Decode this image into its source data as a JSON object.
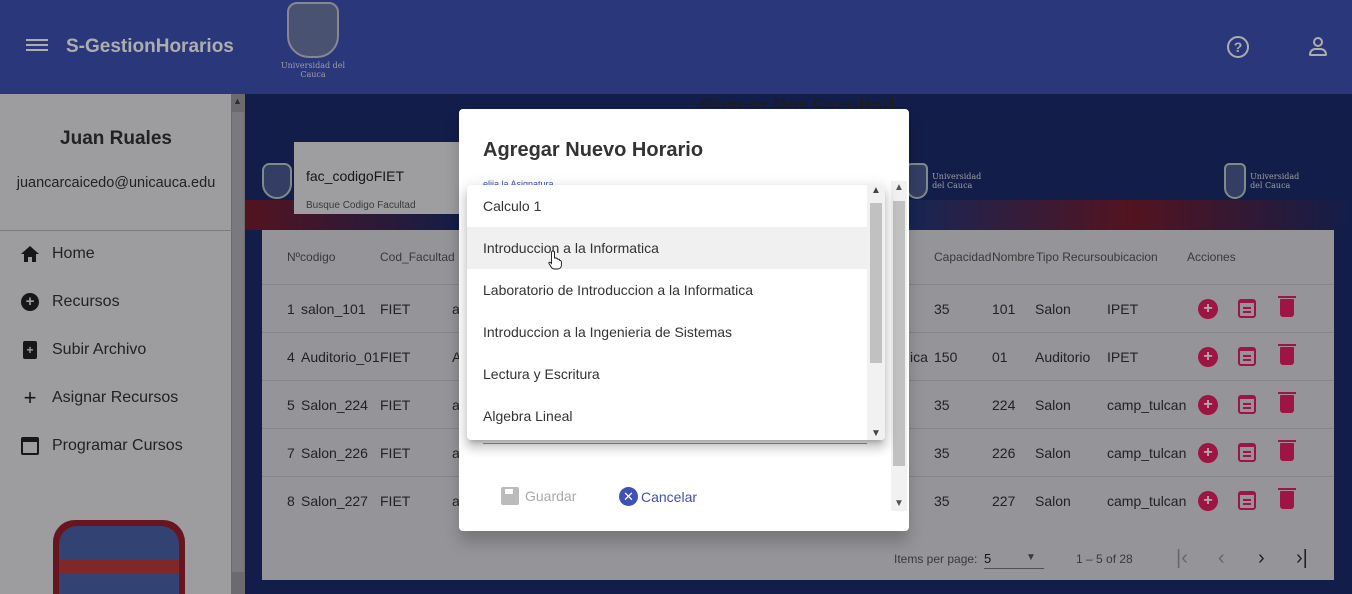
{
  "app": {
    "title": "S-GestionHorarios",
    "logo_text": "Universidad del Cauca"
  },
  "user": {
    "name": "Juan Ruales",
    "email": "juancarcaicedo@unicauca.edu"
  },
  "nav": [
    {
      "label": "Home",
      "icon": "home-icon"
    },
    {
      "label": "Recursos",
      "icon": "add-circle-icon"
    },
    {
      "label": "Subir Archivo",
      "icon": "file-upload-icon"
    },
    {
      "label": "Asignar Recursos",
      "icon": "plus-icon"
    },
    {
      "label": "Programar Cursos",
      "icon": "calendar-icon"
    }
  ],
  "page": {
    "title": "Buscar Por Facultad",
    "search_value": "fac_codigoFIET",
    "search_placeholder": "Busque Codigo Facultad"
  },
  "table": {
    "headers": [
      "Nºcodigo",
      "Cod_Facultad",
      "Capacidad",
      "Nombre",
      "Tipo Recurso",
      "ubicacion",
      "Acciones"
    ],
    "rows": [
      {
        "id": "1",
        "codigo": "salon_101",
        "facultad": "FIET",
        "desc": "a",
        "capacidad": "35",
        "nombre": "101",
        "tipo": "Salon",
        "ubicacion": "IPET"
      },
      {
        "id": "4",
        "codigo": "Auditorio_01",
        "facultad": "FIET",
        "desc": "A",
        "desc_tail": "ica",
        "capacidad": "150",
        "nombre": "01",
        "tipo": "Auditorio",
        "ubicacion": "IPET"
      },
      {
        "id": "5",
        "codigo": "Salon_224",
        "facultad": "FIET",
        "desc": "a",
        "capacidad": "35",
        "nombre": "224",
        "tipo": "Salon",
        "ubicacion": "camp_tulcan"
      },
      {
        "id": "7",
        "codigo": "Salon_226",
        "facultad": "FIET",
        "desc": "a",
        "capacidad": "35",
        "nombre": "226",
        "tipo": "Salon",
        "ubicacion": "camp_tulcan"
      },
      {
        "id": "8",
        "codigo": "Salon_227",
        "facultad": "FIET",
        "desc": "a",
        "capacidad": "35",
        "nombre": "227",
        "tipo": "Salon",
        "ubicacion": "camp_tulcan"
      }
    ]
  },
  "paginator": {
    "items_per_page_label": "Items per page:",
    "page_size": "5",
    "range": "1 – 5 of 28"
  },
  "dialog": {
    "title": "Agregar Nuevo Horario",
    "field_label": "elija la Asignatura",
    "save_label": "Guardar",
    "cancel_label": "Cancelar"
  },
  "dropdown": {
    "options": [
      "Calculo 1",
      "Introduccion a la Informatica",
      "Laboratorio de Introduccion a la Informatica",
      "Introduccion a la Ingenieria de Sistemas",
      "Lectura y Escritura",
      "Algebra Lineal"
    ],
    "hovered": "Introduccion a la Informatica"
  },
  "colors": {
    "primary": "#3f51b5",
    "accent": "#e91e63",
    "banner": "#1c2c6c",
    "crimson": "#9a2030"
  }
}
